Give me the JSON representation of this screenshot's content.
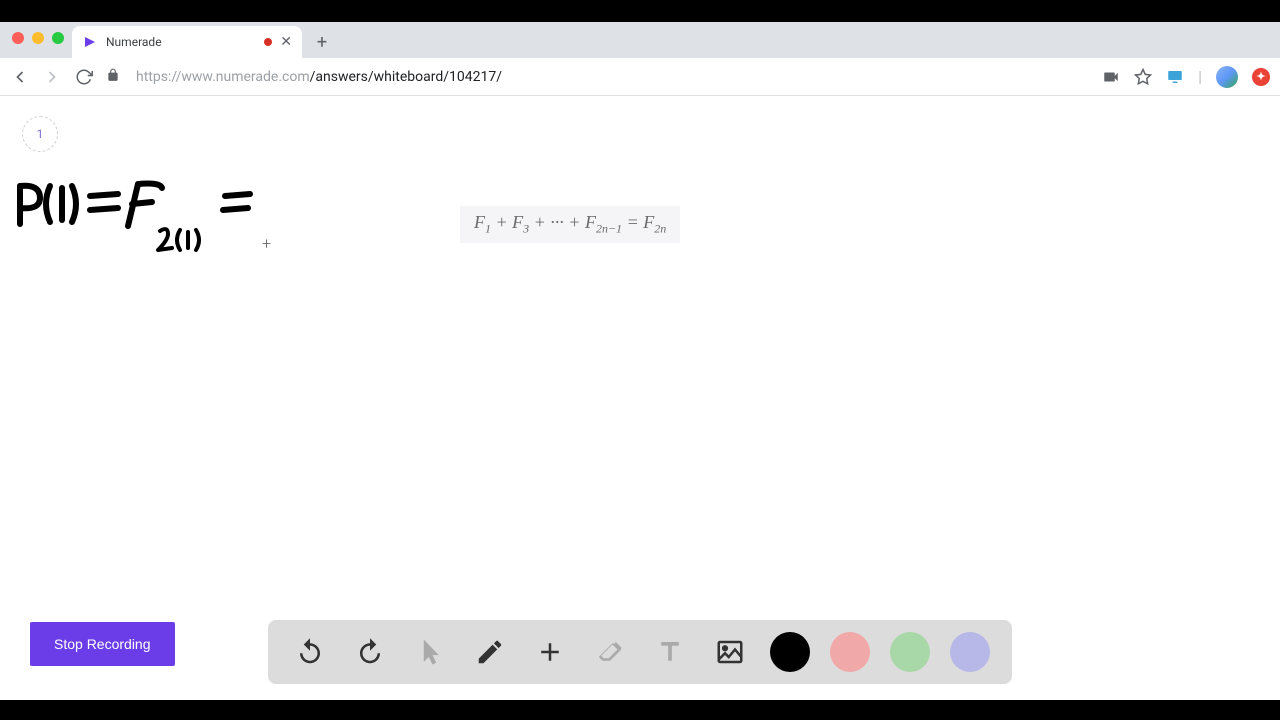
{
  "tab": {
    "title": "Numerade"
  },
  "url": {
    "protocol_host": "https://www.numerade.com",
    "path": "/answers/whiteboard/104217/"
  },
  "page_number": "1",
  "equation": {
    "latex": "F_1 + F_3 + \\cdots + F_{2n-1} = F_{2n}",
    "html": "F<sub>1</sub> + F<sub>3</sub> + &middot;&middot;&middot; + F<sub>2n&minus;1</sub> = F<sub>2n</sub>"
  },
  "handwriting": {
    "text": "P(1) = F_{2(1)} ="
  },
  "stop_button": "Stop Recording",
  "toolbar": {
    "undo": "undo",
    "redo": "redo",
    "pointer": "pointer",
    "pen": "pen",
    "plus": "add",
    "eraser": "eraser",
    "text": "text",
    "image": "image"
  },
  "colors": {
    "black": "#000000",
    "pink": "#f1a8a8",
    "green": "#a8d8a8",
    "purple": "#b8b8e8",
    "accent": "#6a3de8"
  }
}
